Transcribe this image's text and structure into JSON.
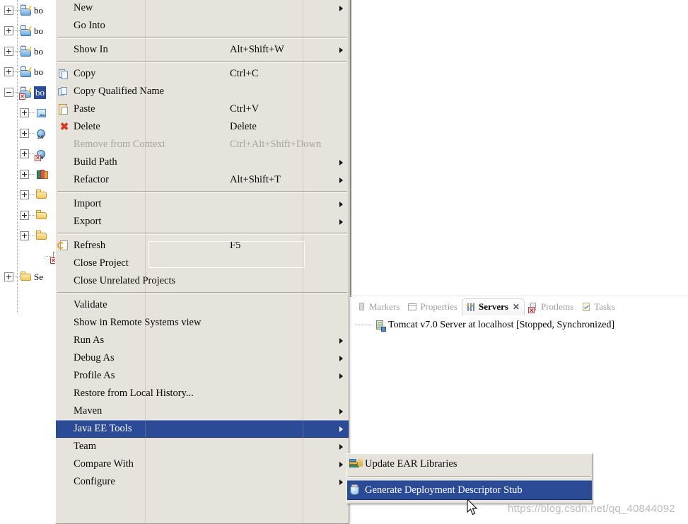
{
  "explorer": {
    "name": "project-explorer",
    "rows": [
      {
        "label": "bo",
        "icon": "maven-project-icon",
        "twisty": "plus",
        "indent": 0,
        "selected": false,
        "error": false
      },
      {
        "label": "bo",
        "icon": "maven-project-icon",
        "twisty": "plus",
        "indent": 0,
        "selected": false,
        "error": false
      },
      {
        "label": "bo",
        "icon": "maven-project-icon",
        "twisty": "plus",
        "indent": 0,
        "selected": false,
        "error": false
      },
      {
        "label": "bo",
        "icon": "maven-project-icon",
        "twisty": "plus",
        "indent": 0,
        "selected": false,
        "error": false
      },
      {
        "label": "bo",
        "icon": "maven-project-icon",
        "twisty": "minus",
        "indent": 0,
        "selected": true,
        "error": true
      },
      {
        "label": "",
        "icon": "source-folder-icon",
        "twisty": "plus",
        "indent": 1,
        "selected": false,
        "error": false
      },
      {
        "label": "",
        "icon": "jre-library-icon",
        "twisty": "plus",
        "indent": 1,
        "selected": false,
        "error": false
      },
      {
        "label": "",
        "icon": "jre-library-icon",
        "twisty": "plus",
        "indent": 1,
        "selected": false,
        "error": true
      },
      {
        "label": "",
        "icon": "library-icon",
        "twisty": "plus",
        "indent": 1,
        "selected": false,
        "error": false
      },
      {
        "label": "",
        "icon": "web-folder-icon",
        "twisty": "plus",
        "indent": 1,
        "selected": false,
        "error": false
      },
      {
        "label": "",
        "icon": "folder-icon",
        "twisty": "plus",
        "indent": 1,
        "selected": false,
        "error": false
      },
      {
        "label": "",
        "icon": "folder-icon",
        "twisty": "plus",
        "indent": 1,
        "selected": false,
        "error": false
      },
      {
        "label": "",
        "icon": "file-icon",
        "twisty": "none",
        "indent": 2,
        "selected": false,
        "error": true
      },
      {
        "label": "Se",
        "icon": "folder-icon",
        "twisty": "plus",
        "indent": 0,
        "selected": false,
        "error": false
      }
    ]
  },
  "context_menu": {
    "name": "project-context-menu",
    "items": [
      {
        "type": "item",
        "label": "New",
        "accel": "",
        "icon": "",
        "arrow": true,
        "disabled": false,
        "selected": false
      },
      {
        "type": "item",
        "label": "Go Into",
        "accel": "",
        "icon": "",
        "arrow": false,
        "disabled": false,
        "selected": false
      },
      {
        "type": "separator"
      },
      {
        "type": "item",
        "label": "Show In",
        "accel": "Alt+Shift+W",
        "icon": "",
        "arrow": true,
        "disabled": false,
        "selected": false
      },
      {
        "type": "separator"
      },
      {
        "type": "item",
        "label": "Copy",
        "accel": "Ctrl+C",
        "icon": "copy-icon",
        "arrow": false,
        "disabled": false,
        "selected": false
      },
      {
        "type": "item",
        "label": "Copy Qualified Name",
        "accel": "",
        "icon": "copy-qualified-icon",
        "arrow": false,
        "disabled": false,
        "selected": false
      },
      {
        "type": "item",
        "label": "Paste",
        "accel": "Ctrl+V",
        "icon": "paste-icon",
        "arrow": false,
        "disabled": false,
        "selected": false
      },
      {
        "type": "item",
        "label": "Delete",
        "accel": "Delete",
        "icon": "delete-icon",
        "arrow": false,
        "disabled": false,
        "selected": false
      },
      {
        "type": "item",
        "label": "Remove from Context",
        "accel": "Ctrl+Alt+Shift+Down",
        "icon": "",
        "arrow": false,
        "disabled": true,
        "selected": false
      },
      {
        "type": "item",
        "label": "Build Path",
        "accel": "",
        "icon": "",
        "arrow": true,
        "disabled": false,
        "selected": false
      },
      {
        "type": "item",
        "label": "Refactor",
        "accel": "Alt+Shift+T",
        "icon": "",
        "arrow": true,
        "disabled": false,
        "selected": false
      },
      {
        "type": "separator"
      },
      {
        "type": "item",
        "label": "Import",
        "accel": "",
        "icon": "",
        "arrow": true,
        "disabled": false,
        "selected": false
      },
      {
        "type": "item",
        "label": "Export",
        "accel": "",
        "icon": "",
        "arrow": true,
        "disabled": false,
        "selected": false
      },
      {
        "type": "separator"
      },
      {
        "type": "item",
        "label": "Refresh",
        "accel": "F5",
        "icon": "refresh-icon",
        "arrow": false,
        "disabled": false,
        "selected": false
      },
      {
        "type": "item",
        "label": "Close Project",
        "accel": "",
        "icon": "",
        "arrow": false,
        "disabled": false,
        "selected": false
      },
      {
        "type": "item",
        "label": "Close Unrelated Projects",
        "accel": "",
        "icon": "",
        "arrow": false,
        "disabled": false,
        "selected": false
      },
      {
        "type": "separator"
      },
      {
        "type": "item",
        "label": "Validate",
        "accel": "",
        "icon": "",
        "arrow": false,
        "disabled": false,
        "selected": false
      },
      {
        "type": "item",
        "label": "Show in Remote Systems view",
        "accel": "",
        "icon": "",
        "arrow": false,
        "disabled": false,
        "selected": false
      },
      {
        "type": "item",
        "label": "Run As",
        "accel": "",
        "icon": "",
        "arrow": true,
        "disabled": false,
        "selected": false
      },
      {
        "type": "item",
        "label": "Debug As",
        "accel": "",
        "icon": "",
        "arrow": true,
        "disabled": false,
        "selected": false
      },
      {
        "type": "item",
        "label": "Profile As",
        "accel": "",
        "icon": "",
        "arrow": true,
        "disabled": false,
        "selected": false
      },
      {
        "type": "item",
        "label": "Restore from Local History...",
        "accel": "",
        "icon": "",
        "arrow": false,
        "disabled": false,
        "selected": false
      },
      {
        "type": "item",
        "label": "Maven",
        "accel": "",
        "icon": "",
        "arrow": true,
        "disabled": false,
        "selected": false
      },
      {
        "type": "item",
        "label": "Java EE Tools",
        "accel": "",
        "icon": "",
        "arrow": true,
        "disabled": false,
        "selected": true
      },
      {
        "type": "item",
        "label": "Team",
        "accel": "",
        "icon": "",
        "arrow": true,
        "disabled": false,
        "selected": false
      },
      {
        "type": "item",
        "label": "Compare With",
        "accel": "",
        "icon": "",
        "arrow": true,
        "disabled": false,
        "selected": false
      },
      {
        "type": "item",
        "label": "Configure",
        "accel": "",
        "icon": "",
        "arrow": true,
        "disabled": false,
        "selected": false
      }
    ]
  },
  "submenu": {
    "name": "java-ee-tools-submenu",
    "items": [
      {
        "type": "item",
        "label": "Update EAR Libraries",
        "icon": "ear-libraries-icon",
        "selected": false
      },
      {
        "type": "separator"
      },
      {
        "type": "item",
        "label": "Generate Deployment Descriptor Stub",
        "icon": "generate-stub-icon",
        "selected": true
      }
    ]
  },
  "view_stack": {
    "name": "bottom-view-stack",
    "tabs": [
      {
        "label": "Markers",
        "icon": "markers-icon",
        "active": false,
        "closeable": false
      },
      {
        "label": "Properties",
        "icon": "properties-icon",
        "active": false,
        "closeable": false
      },
      {
        "label": "Servers",
        "icon": "servers-icon",
        "active": true,
        "closeable": true,
        "close_glyph": "✕"
      },
      {
        "label": "Protlems",
        "icon": "problems-icon",
        "active": false,
        "closeable": false
      },
      {
        "label": "Tasks",
        "icon": "tasks-icon",
        "active": false,
        "closeable": false
      }
    ],
    "server_entry": {
      "label": "Tomcat v7.0 Server at localhost  [Stopped, Synchronized]",
      "icon": "server-node-icon"
    }
  },
  "watermark": {
    "text": "https://blog.csdn.net/qq_40844092"
  },
  "colors": {
    "menu_background": "#e6e3dc",
    "menu_border": "#9d9d97",
    "highlight": "#2b4b96",
    "highlight_text": "#ffffff",
    "disabled_text": "#a8a49c",
    "tree_selected": "#2c4c96",
    "editor_background": "#ffffff"
  }
}
